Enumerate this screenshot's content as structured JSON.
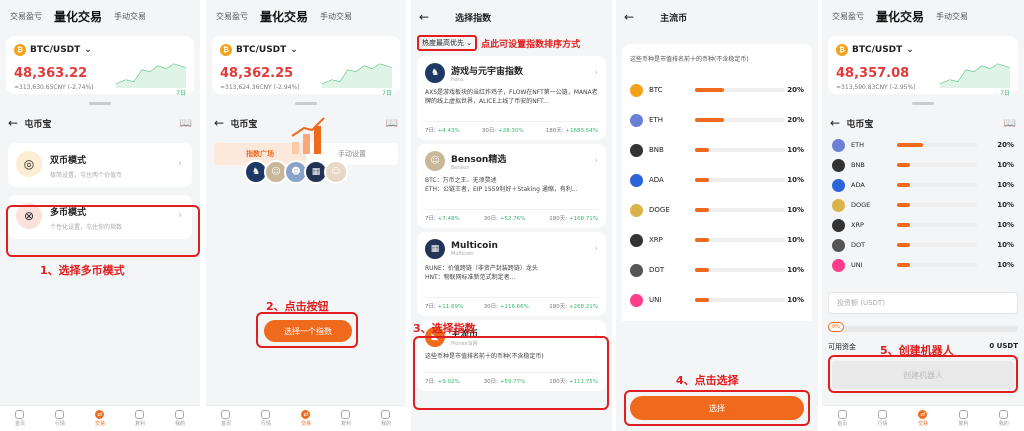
{
  "common": {
    "tab_pnl": "交易盈亏",
    "tab_quant": "量化交易",
    "tab_manual": "手动交易",
    "pair": "BTC/USDT",
    "period": "7日",
    "nav": [
      "首页",
      "行情",
      "交易",
      "复利",
      "我的"
    ],
    "product_title": "屯币宝",
    "accent": "#f06a1d",
    "red": "#e02020",
    "green": "#35b86b"
  },
  "p1": {
    "price": "48,363.22",
    "cny": "≈313,630.65CNY (-2.74%)",
    "modes": [
      {
        "title": "双币模式",
        "sub": "极简设置，屯住两个价值币"
      },
      {
        "title": "多币模式",
        "sub": "个性化设置，屯住你的指数"
      }
    ],
    "step_label": "1、选择多币模式"
  },
  "p2": {
    "price": "48,362.25",
    "cny": "≈313,624.36CNY (-2.94%)",
    "seg_tabs": [
      "指数广场",
      "手动设置"
    ],
    "button": "选择一个指数",
    "step_label": "2、点击按钮"
  },
  "p3": {
    "title": "选择指数",
    "sort": "热度最高优先",
    "sort_note": "点此可设置指数排序方式",
    "cards": [
      {
        "name": "游戏与元宇宙指数",
        "sub": "Hans",
        "desc": "AXS是游戏板块的当红炸鸡子，FLOW在NFT第一公链，MANA老牌的线上虚拟世界，ALICE上线了币安的NFT...",
        "s7": "7日: ",
        "v7": "+4.43%",
        "s30": "30日: ",
        "v30": "+28.30%",
        "s180": "180天: ",
        "v180": "+1683.54%"
      },
      {
        "name": "Benson精选",
        "sub": "Benson",
        "desc": "BTC：万币之王、无须赘述\nETH：公链王者，EIP 1559利好＋Staking 通缩，有利...",
        "s7": "7日: ",
        "v7": "+7.48%",
        "s30": "30日: ",
        "v30": "+52.76%",
        "s180": "180天: ",
        "v180": "+168.71%"
      },
      {
        "name": "Multicoin",
        "sub": "Multicoin",
        "desc": "RUNE：价值跨链（非资产封装跨链）龙头\nHNT：物联网标准新范式制定者...",
        "s7": "7日: ",
        "v7": "+11.69%",
        "s30": "30日: ",
        "v30": "+116.66%",
        "s180": "180天: ",
        "v180": "+268.21%"
      },
      {
        "name": "主流币",
        "sub": "Pionex派网",
        "desc": "这些币种是市值排名前十的币种(不含稳定币)",
        "s7": "7日: ",
        "v7": "+9.02%",
        "s30": "30日: ",
        "v30": "+59.77%",
        "s180": "180天: ",
        "v180": "+111.75%"
      }
    ],
    "step_label": "3、选择指数"
  },
  "p4": {
    "title": "主流币",
    "desc": "这些币种是市值排名前十的币种(不含稳定币)",
    "coins": [
      {
        "sym": "BTC",
        "pct": "20%",
        "w": 0.2,
        "color": "#f3a21b"
      },
      {
        "sym": "ETH",
        "pct": "20%",
        "w": 0.2,
        "color": "#6b7fd7"
      },
      {
        "sym": "BNB",
        "pct": "10%",
        "w": 0.1,
        "color": "#333333"
      },
      {
        "sym": "ADA",
        "pct": "10%",
        "w": 0.1,
        "color": "#2b63d9"
      },
      {
        "sym": "DOGE",
        "pct": "10%",
        "w": 0.1,
        "color": "#d9b44a"
      },
      {
        "sym": "XRP",
        "pct": "10%",
        "w": 0.1,
        "color": "#333333"
      },
      {
        "sym": "DOT",
        "pct": "10%",
        "w": 0.1,
        "color": "#555555"
      },
      {
        "sym": "UNI",
        "pct": "10%",
        "w": 0.1,
        "color": "#ff3d8b"
      }
    ],
    "button": "选择",
    "step_label": "4、点击选择"
  },
  "p5": {
    "price": "48,357.08",
    "cny": "≈313,590.83CNY (-2.95%)",
    "coins": [
      {
        "sym": "ETH",
        "pct": "20%",
        "w": 0.2,
        "color": "#6b7fd7"
      },
      {
        "sym": "BNB",
        "pct": "10%",
        "w": 0.1,
        "color": "#333333"
      },
      {
        "sym": "ADA",
        "pct": "10%",
        "w": 0.1,
        "color": "#2b63d9"
      },
      {
        "sym": "DOGE",
        "pct": "10%",
        "w": 0.1,
        "color": "#d9b44a"
      },
      {
        "sym": "XRP",
        "pct": "10%",
        "w": 0.1,
        "color": "#333333"
      },
      {
        "sym": "DOT",
        "pct": "10%",
        "w": 0.1,
        "color": "#555555"
      },
      {
        "sym": "UNI",
        "pct": "10%",
        "w": 0.1,
        "color": "#ff3d8b"
      }
    ],
    "amount_placeholder": "投资额 (USDT)",
    "slider_pct": "0%",
    "funds_label": "可用资金",
    "funds_value": "0 USDT",
    "button": "创建机器人",
    "step_label": "5、创建机器人"
  }
}
